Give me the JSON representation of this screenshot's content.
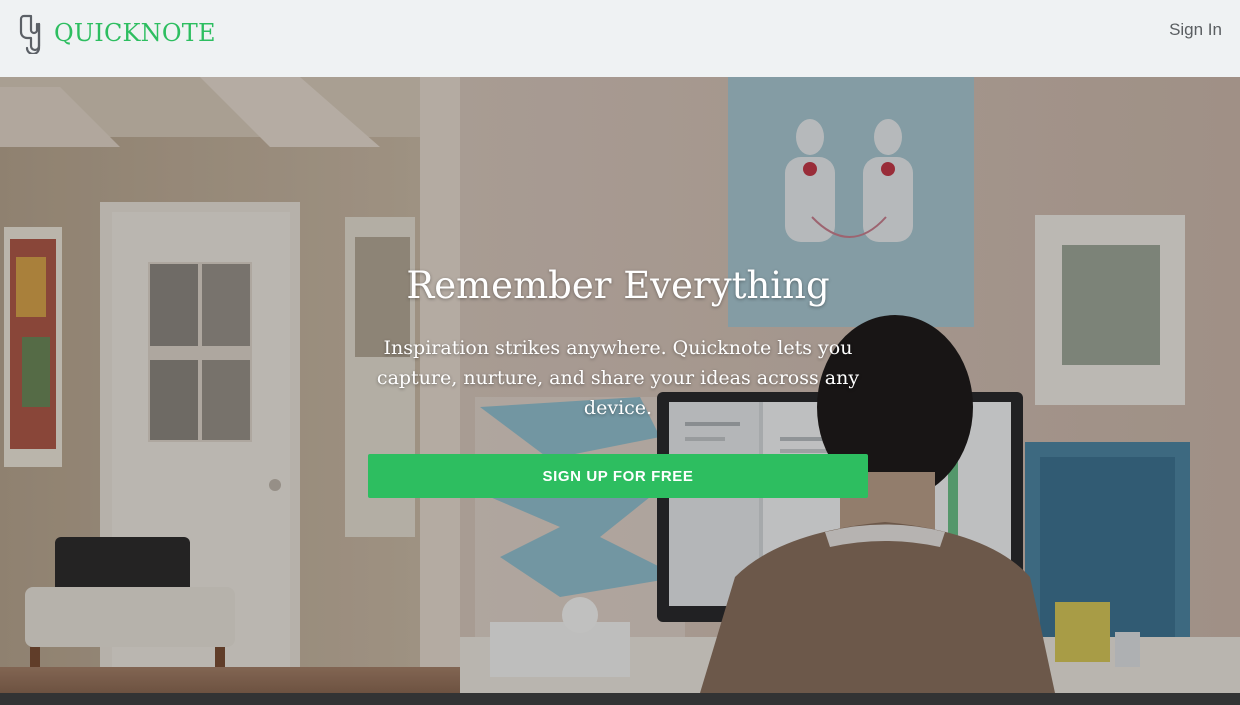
{
  "header": {
    "brand": "QUICKNOTE",
    "logo_icon": "paperclip-icon",
    "signin_label": "Sign In"
  },
  "hero": {
    "title": "Remember Everything",
    "subtitle": "Inspiration strikes anywhere. Quicknote lets you capture, nurture, and share your ideas across any device.",
    "cta_label": "SIGN UP FOR FREE"
  },
  "colors": {
    "brand": "#2dbe60",
    "header_bg": "#eff2f3",
    "signin_text": "#5a5e61"
  }
}
